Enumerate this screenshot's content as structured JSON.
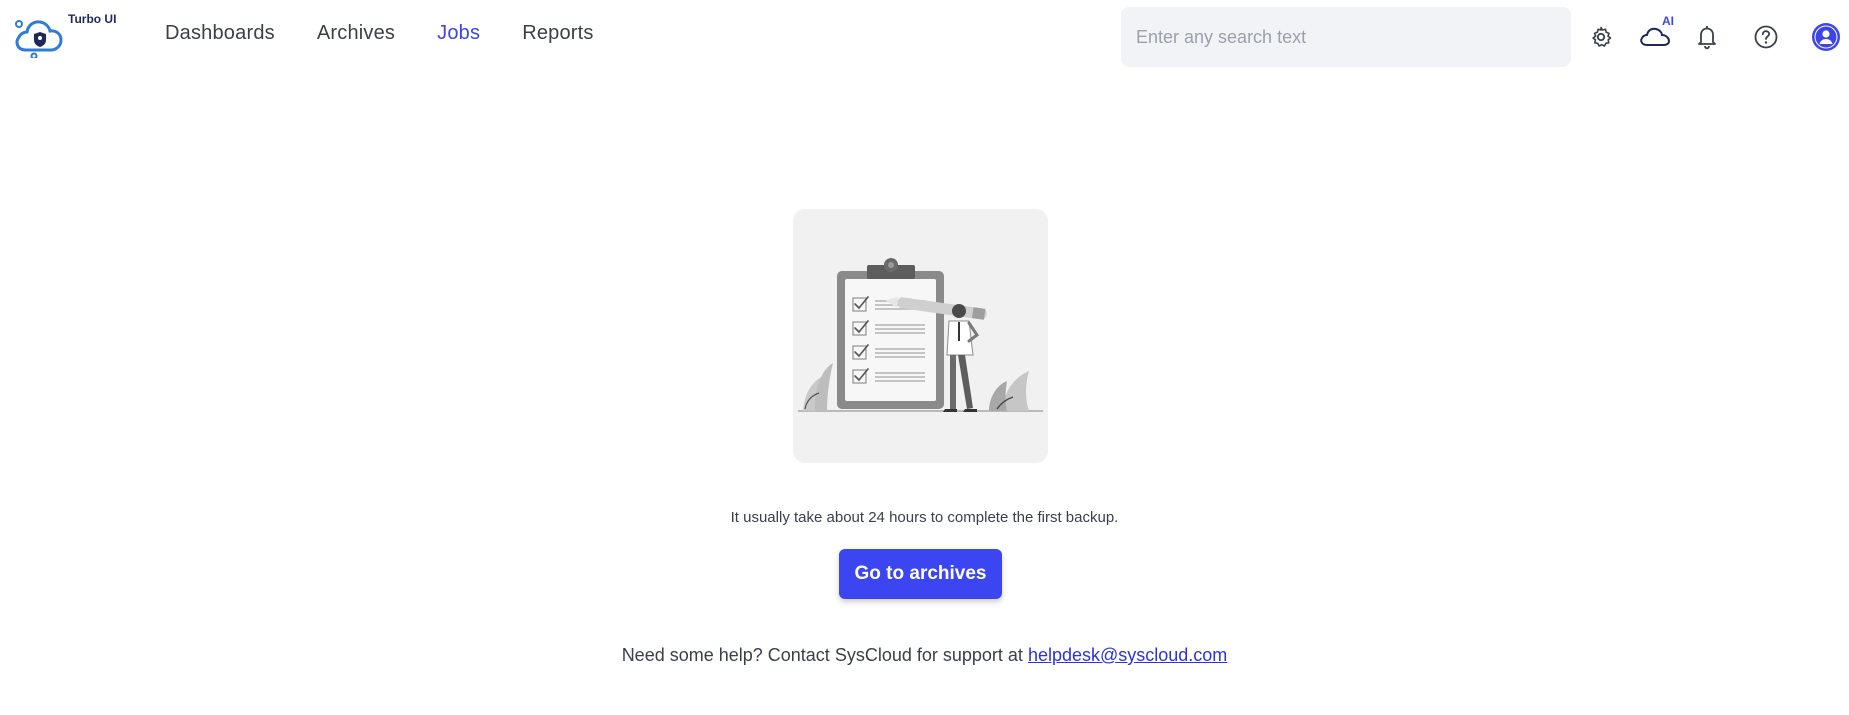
{
  "app": {
    "name": "Turbo UI"
  },
  "nav": {
    "items": [
      {
        "label": "Dashboards",
        "active": false
      },
      {
        "label": "Archives",
        "active": false
      },
      {
        "label": "Jobs",
        "active": true
      },
      {
        "label": "Reports",
        "active": false
      }
    ]
  },
  "search": {
    "placeholder": "Enter any search text",
    "value": ""
  },
  "toolbar": {
    "icons": [
      "gear-icon",
      "ai-cloud-icon",
      "bell-icon",
      "help-icon",
      "user-avatar-icon"
    ],
    "ai_label": "AI"
  },
  "empty_state": {
    "illustration": "clipboard-checklist-illustration",
    "message": "It usually take about 24 hours to complete the first backup.",
    "button_label": "Go to archives"
  },
  "footer": {
    "help_text": "Need some help? Contact SysCloud for support at",
    "email": "helpdesk@syscloud.com"
  },
  "colors": {
    "accent": "#3c46f0",
    "nav_active": "#3c46e8",
    "search_bg": "#f1f3f7",
    "illustration_bg": "#f1f1f1"
  }
}
